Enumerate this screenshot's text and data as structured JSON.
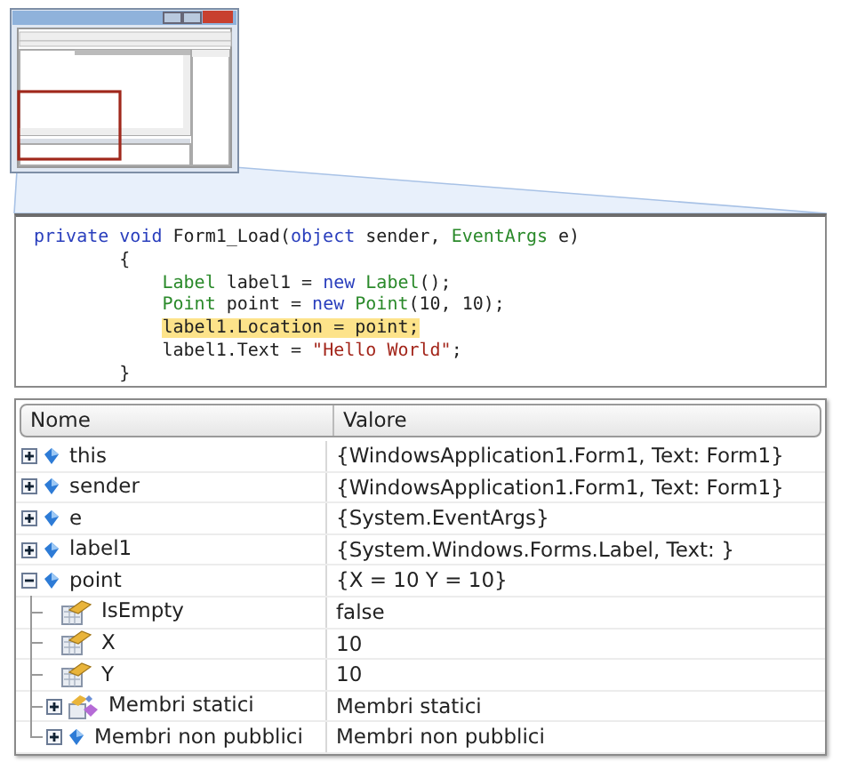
{
  "code": {
    "lines": [
      {
        "highlighted": false,
        "tokens": [
          {
            "text": "private void",
            "kind": "keyword"
          },
          {
            "text": " Form1_Load(",
            "kind": "plain"
          },
          {
            "text": "object",
            "kind": "keyword"
          },
          {
            "text": " sender, ",
            "kind": "plain"
          },
          {
            "text": "EventArgs",
            "kind": "type"
          },
          {
            "text": " e)",
            "kind": "plain"
          }
        ]
      },
      {
        "highlighted": false,
        "tokens": [
          {
            "text": "        {",
            "kind": "plain"
          }
        ]
      },
      {
        "highlighted": false,
        "tokens": [
          {
            "text": "            Label",
            "kind": "type"
          },
          {
            "text": " label1 = ",
            "kind": "plain"
          },
          {
            "text": "new",
            "kind": "keyword"
          },
          {
            "text": " Label",
            "kind": "type"
          },
          {
            "text": "();",
            "kind": "plain"
          }
        ]
      },
      {
        "highlighted": false,
        "tokens": [
          {
            "text": "            Point",
            "kind": "type"
          },
          {
            "text": " point = ",
            "kind": "plain"
          },
          {
            "text": "new",
            "kind": "keyword"
          },
          {
            "text": " Point",
            "kind": "type"
          },
          {
            "text": "(10, 10);",
            "kind": "plain"
          }
        ]
      },
      {
        "highlighted": true,
        "tokens": [
          {
            "text": "            label1.Location = point;",
            "kind": "plain"
          }
        ]
      },
      {
        "highlighted": false,
        "tokens": [
          {
            "text": "            label1.Text = ",
            "kind": "plain"
          },
          {
            "text": "\"Hello World\"",
            "kind": "string"
          },
          {
            "text": ";",
            "kind": "plain"
          }
        ]
      },
      {
        "highlighted": false,
        "tokens": [
          {
            "text": "        }",
            "kind": "plain"
          }
        ]
      }
    ]
  },
  "watch": {
    "columns": [
      "Nome",
      "Valore"
    ],
    "rows": [
      {
        "name": "this",
        "value": "{WindowsApplication1.Form1, Text: Form1}",
        "kind": "field",
        "expanded": false
      },
      {
        "name": "sender",
        "value": "{WindowsApplication1.Form1, Text: Form1}",
        "kind": "field",
        "expanded": false
      },
      {
        "name": "e",
        "value": "{System.EventArgs}",
        "kind": "field",
        "expanded": false
      },
      {
        "name": "label1",
        "value": "{System.Windows.Forms.Label, Text: }",
        "kind": "field",
        "expanded": false
      },
      {
        "name": "point",
        "value": "{X = 10 Y = 10}",
        "kind": "field",
        "expanded": true,
        "children": [
          {
            "name": "IsEmpty",
            "value": "false",
            "kind": "property"
          },
          {
            "name": "X",
            "value": "10",
            "kind": "property"
          },
          {
            "name": "Y",
            "value": "10",
            "kind": "property"
          },
          {
            "name": "Membri statici",
            "value": "Membri statici",
            "kind": "static",
            "expanded": false
          },
          {
            "name": "Membri non pubblici",
            "value": "Membri non pubblici",
            "kind": "field",
            "expanded": false
          }
        ]
      }
    ]
  }
}
